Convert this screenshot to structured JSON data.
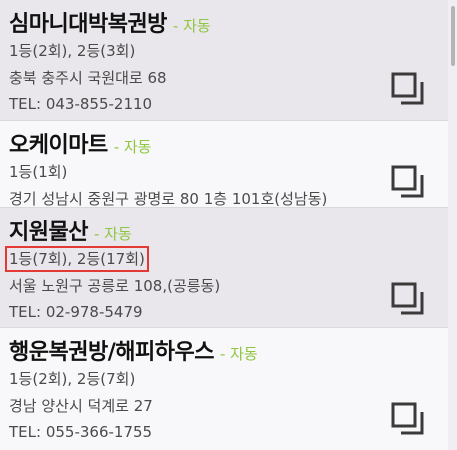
{
  "stores": [
    {
      "name": "심마니대박복권방",
      "auto_label": "- 자동",
      "wins": "1등(2회), 2등(3회)",
      "address": "충북 충주시 국원대로 68",
      "phone": "TEL: 043-855-2110",
      "copy_icon": "copy-icon"
    },
    {
      "name": "오케이마트",
      "auto_label": "- 자동",
      "wins": "1등(1회)",
      "address": "경기 성남시 중원구 광명로 80 1층 101호(성남동)",
      "phone": "",
      "copy_icon": "copy-icon"
    },
    {
      "name": "지원물산",
      "auto_label": "- 자동",
      "wins": "1등(7회), 2등(17회)",
      "address": "서울 노원구 공릉로 108,(공릉동)",
      "phone": "TEL: 02-978-5479",
      "copy_icon": "copy-icon"
    },
    {
      "name": "행운복권방/해피하우스",
      "auto_label": "- 자동",
      "wins": "1등(2회), 2등(7회)",
      "address": "경남 양산시 덕계로 27",
      "phone": "TEL: 055-366-1755",
      "copy_icon": "copy-icon"
    }
  ],
  "colors": {
    "auto_label": "#8ec63f",
    "highlight_box": "#e53935",
    "name_text": "#111111",
    "detail_text": "#4a4a4a"
  }
}
